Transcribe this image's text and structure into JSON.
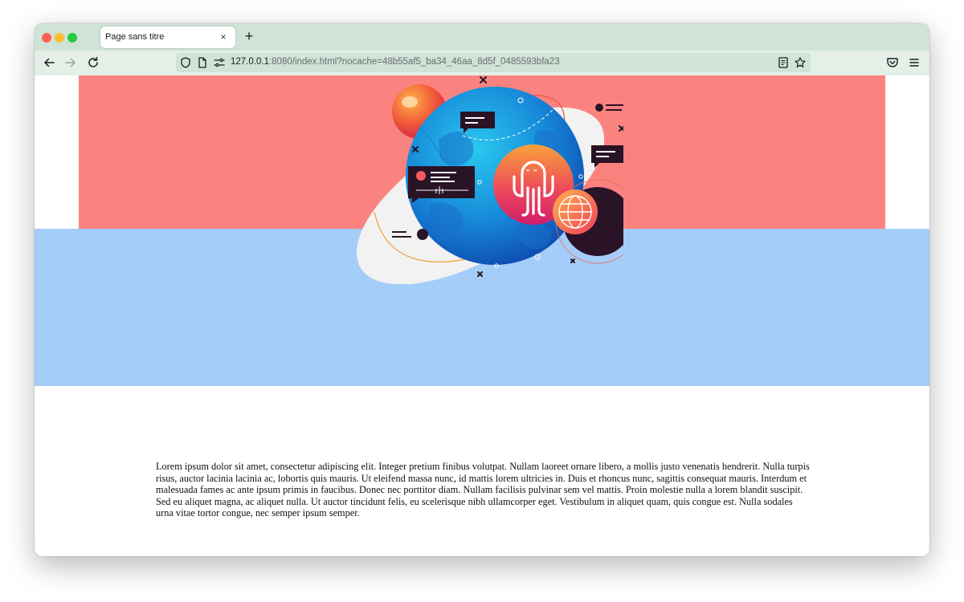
{
  "browser": {
    "tab": {
      "title": "Page sans titre",
      "close_label": "×"
    },
    "new_tab_label": "+",
    "url": {
      "host": "127.0.0.1",
      "rest": ":8080/index.html?nocache=48b55af5_ba34_46aa_8d5f_0485593bfa23"
    },
    "icons": [
      "back-icon",
      "forward-icon",
      "reload-icon",
      "shield-icon",
      "page-icon",
      "permissions-icon",
      "reader-view-icon",
      "bookmark-star-icon",
      "pocket-icon",
      "menu-icon"
    ]
  },
  "page": {
    "colors": {
      "banner": "#fa8380",
      "section": "#a5cdf9"
    },
    "illustration": "octopus-globe-illustration",
    "body_text": "Lorem ipsum dolor sit amet, consectetur adipiscing elit. Integer pretium finibus volutpat. Nullam laoreet ornare libero, a mollis justo venenatis hendrerit. Nulla turpis risus, auctor lacinia lacinia ac, lobortis quis mauris. Ut eleifend massa nunc, id mattis lorem ultricies in. Duis et rhoncus nunc, sagittis consequat mauris. Interdum et malesuada fames ac ante ipsum primis in faucibus. Donec nec porttitor diam. Nullam facilisis pulvinar sem vel mattis. Proin molestie nulla a lorem blandit suscipit. Sed eu aliquet magna, ac aliquet nulla. Ut auctor tincidunt felis, eu scelerisque nibh ullamcorper eget. Vestibulum in aliquet quam, quis congue est. Nulla sodales urna vitae tortor congue, nec semper ipsum semper."
  }
}
